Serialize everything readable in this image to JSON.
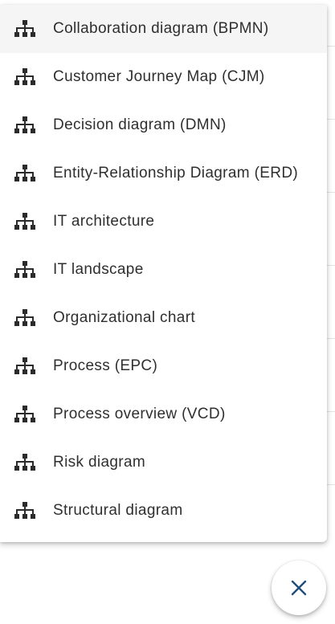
{
  "menu": {
    "items": [
      {
        "label": "Collaboration diagram (BPMN)",
        "icon": "diagram-hierarchy-icon",
        "highlighted": true
      },
      {
        "label": "Customer Journey Map (CJM)",
        "icon": "diagram-hierarchy-icon"
      },
      {
        "label": "Decision diagram (DMN)",
        "icon": "diagram-hierarchy-icon"
      },
      {
        "label": "Entity-Relationship Diagram (ERD)",
        "icon": "diagram-hierarchy-icon"
      },
      {
        "label": "IT architecture",
        "icon": "diagram-hierarchy-icon"
      },
      {
        "label": "IT landscape",
        "icon": "diagram-hierarchy-icon"
      },
      {
        "label": "Organizational chart",
        "icon": "diagram-hierarchy-icon"
      },
      {
        "label": "Process (EPC)",
        "icon": "diagram-hierarchy-icon"
      },
      {
        "label": "Process overview (VCD)",
        "icon": "diagram-hierarchy-icon"
      },
      {
        "label": "Risk diagram",
        "icon": "diagram-hierarchy-icon"
      },
      {
        "label": "Structural diagram",
        "icon": "diagram-hierarchy-icon"
      }
    ]
  },
  "fab": {
    "icon": "close-icon",
    "color": "#1f4f7a"
  },
  "colors": {
    "text": "#2f2f2f",
    "icon": "#2b2b2b",
    "highlight": "#f5f5f5"
  }
}
